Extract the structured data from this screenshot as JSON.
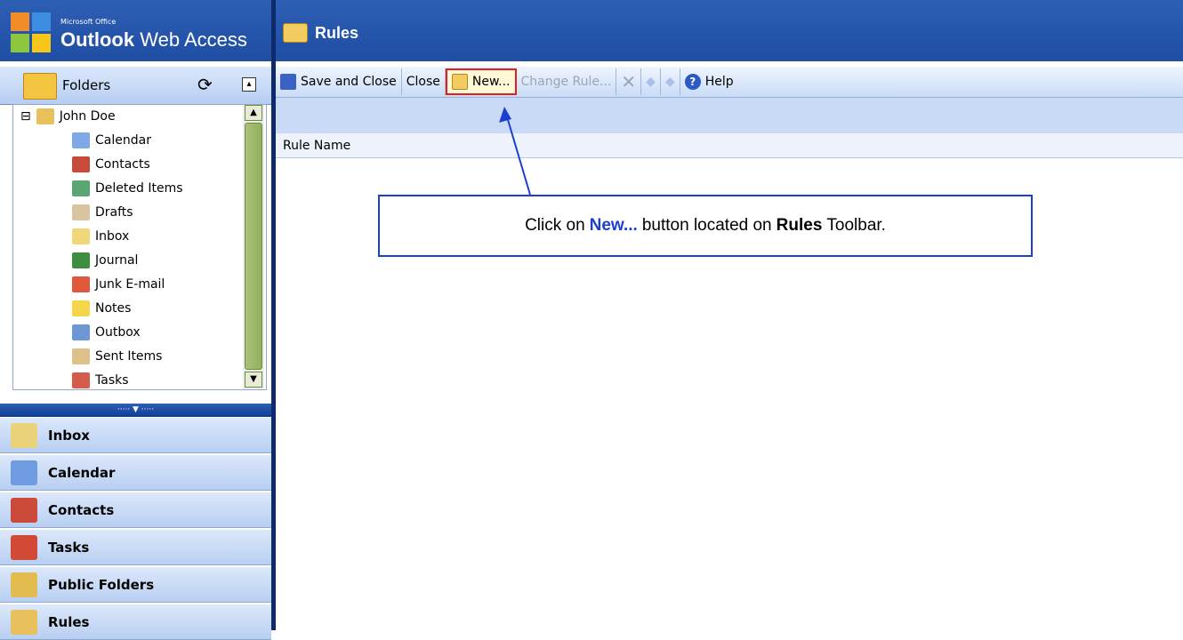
{
  "header": {
    "brand_small": "Microsoft Office",
    "brand_bold": "Outlook",
    "brand_rest": " Web Access",
    "page_title": "Rules"
  },
  "folders_pane": {
    "title": "Folders",
    "refresh_icon": "refresh-icon",
    "expand_glyph": "▴",
    "tree": [
      {
        "label": "John Doe",
        "icon": "mailbox-icon",
        "color": "#e8c15c"
      },
      {
        "label": "Calendar",
        "icon": "calendar-icon",
        "color": "#7fa8e6"
      },
      {
        "label": "Contacts",
        "icon": "contacts-icon",
        "color": "#c84b3a"
      },
      {
        "label": "Deleted Items",
        "icon": "deleted-items-icon",
        "color": "#57a673"
      },
      {
        "label": "Drafts",
        "icon": "drafts-icon",
        "color": "#d9c4a0"
      },
      {
        "label": "Inbox",
        "icon": "inbox-icon",
        "color": "#f1d77a"
      },
      {
        "label": "Journal",
        "icon": "journal-icon",
        "color": "#3f8d3f"
      },
      {
        "label": "Junk E-mail",
        "icon": "junk-email-icon",
        "color": "#e0583a"
      },
      {
        "label": "Notes",
        "icon": "notes-icon",
        "color": "#f5d64a"
      },
      {
        "label": "Outbox",
        "icon": "outbox-icon",
        "color": "#6c96d4"
      },
      {
        "label": "Sent Items",
        "icon": "sent-items-icon",
        "color": "#dcc28a"
      },
      {
        "label": "Tasks",
        "icon": "tasks-icon",
        "color": "#d55b4a"
      }
    ]
  },
  "splitter_glyph": "····· ▼ ·····",
  "nav_buttons": [
    {
      "label": "Inbox",
      "icon": "inbox-icon",
      "color": "#e9d27a"
    },
    {
      "label": "Calendar",
      "icon": "calendar-icon",
      "color": "#6f9be0"
    },
    {
      "label": "Contacts",
      "icon": "contacts-icon",
      "color": "#cc4a3a"
    },
    {
      "label": "Tasks",
      "icon": "tasks-icon",
      "color": "#d24a36"
    },
    {
      "label": "Public Folders",
      "icon": "public-folders-icon",
      "color": "#e3bc4f"
    },
    {
      "label": "Rules",
      "icon": "rules-icon",
      "color": "#e8c15c"
    }
  ],
  "toolbar": {
    "save_close": "Save and Close",
    "close": "Close",
    "new": "New...",
    "change_rule": "Change Rule...",
    "delete_glyph": "✕",
    "up_glyph": "◆",
    "down_glyph": "◆",
    "help": "Help"
  },
  "column_header": "Rule Name",
  "callout": {
    "part1": "Click on",
    "new_text": "New...",
    "part2": "button located on",
    "rules_text": "Rules",
    "part3": "Toolbar."
  },
  "colors": {
    "header_blue": "#2556ab",
    "highlight_red": "#e02020",
    "callout_blue": "#1d3fd0"
  }
}
